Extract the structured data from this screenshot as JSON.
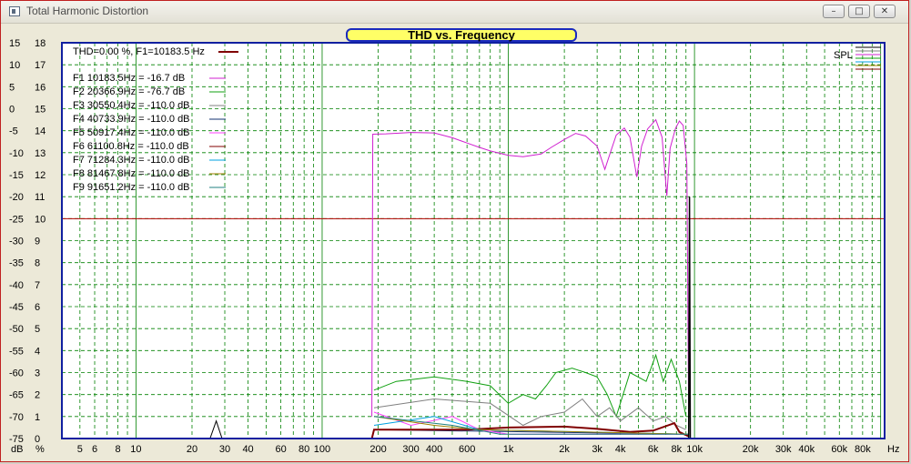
{
  "window": {
    "title": "Total Harmonic Distortion",
    "buttons": {
      "minimize": "–",
      "maximize": "□",
      "close": "✕"
    }
  },
  "chart_data": {
    "type": "line",
    "title": "THD vs. Frequency",
    "x_scale": "log",
    "xlim": [
      4,
      105000
    ],
    "x_unit_label": "Hz",
    "x_ticks": [
      {
        "v": 5,
        "l": "5"
      },
      {
        "v": 6,
        "l": "6"
      },
      {
        "v": 8,
        "l": "8"
      },
      {
        "v": 10,
        "l": "10"
      },
      {
        "v": 20,
        "l": "20"
      },
      {
        "v": 30,
        "l": "30"
      },
      {
        "v": 40,
        "l": "40"
      },
      {
        "v": 60,
        "l": "60"
      },
      {
        "v": 80,
        "l": "80"
      },
      {
        "v": 100,
        "l": "100"
      },
      {
        "v": 200,
        "l": "200"
      },
      {
        "v": 300,
        "l": "300"
      },
      {
        "v": 400,
        "l": "400"
      },
      {
        "v": 600,
        "l": "600"
      },
      {
        "v": 1000,
        "l": "1k"
      },
      {
        "v": 2000,
        "l": "2k"
      },
      {
        "v": 3000,
        "l": "3k"
      },
      {
        "v": 4000,
        "l": "4k"
      },
      {
        "v": 6000,
        "l": "6k"
      },
      {
        "v": 8000,
        "l": "8k"
      },
      {
        "v": 10000,
        "l": "10k"
      },
      {
        "v": 20000,
        "l": "20k"
      },
      {
        "v": 30000,
        "l": "30k"
      },
      {
        "v": 40000,
        "l": "40k"
      },
      {
        "v": 60000,
        "l": "60k"
      },
      {
        "v": 80000,
        "l": "80k"
      }
    ],
    "y_db_label": "dB",
    "y_pct_label": "%",
    "ylim_db": [
      -75,
      15
    ],
    "db_ticks": [
      "15",
      "10",
      "5",
      "0",
      "-5",
      "-10",
      "-15",
      "-20",
      "-25",
      "-30",
      "-35",
      "-40",
      "-45",
      "-50",
      "-55",
      "-60",
      "-65",
      "-70",
      "-75"
    ],
    "pct_ticks": [
      "18",
      "17",
      "16",
      "15",
      "14",
      "13",
      "12",
      "11",
      "10",
      "9",
      "8",
      "7",
      "6",
      "5",
      "4",
      "3",
      "2",
      "1",
      "0"
    ],
    "reference_line_db": -25,
    "grid": true,
    "legend_position": "top-left",
    "thd_label": "THD=0.00 %, F1=10183.5 Hz",
    "spl_label": "SPL",
    "series": [
      {
        "name": "F1 10183.5Hz = -16.7 dB",
        "color": "#d020d0",
        "points": [
          [
            185,
            -70
          ],
          [
            187,
            -5.8
          ],
          [
            220,
            -5.7
          ],
          [
            300,
            -5.4
          ],
          [
            400,
            -5.5
          ],
          [
            500,
            -6.6
          ],
          [
            600,
            -7.8
          ],
          [
            700,
            -8.8
          ],
          [
            800,
            -9.6
          ],
          [
            1000,
            -10.6
          ],
          [
            1200,
            -10.9
          ],
          [
            1500,
            -10.3
          ],
          [
            1700,
            -8.8
          ],
          [
            2000,
            -7.0
          ],
          [
            2300,
            -5.6
          ],
          [
            2600,
            -6.2
          ],
          [
            3000,
            -8.5
          ],
          [
            3300,
            -13.8
          ],
          [
            3500,
            -10.5
          ],
          [
            3800,
            -6.0
          ],
          [
            4200,
            -4.4
          ],
          [
            4500,
            -6.5
          ],
          [
            4900,
            -15.5
          ],
          [
            5200,
            -8.5
          ],
          [
            5600,
            -4.6
          ],
          [
            6200,
            -2.5
          ],
          [
            6700,
            -6.5
          ],
          [
            7100,
            -19.8
          ],
          [
            7400,
            -9.0
          ],
          [
            7900,
            -4.5
          ],
          [
            8300,
            -2.8
          ],
          [
            8700,
            -3.8
          ],
          [
            9100,
            -12.5
          ],
          [
            9300,
            -70
          ]
        ]
      },
      {
        "name": "F2 20366.9Hz = -76.7 dB",
        "color": "#10a010",
        "points": [
          [
            190,
            -64
          ],
          [
            250,
            -62
          ],
          [
            400,
            -61
          ],
          [
            600,
            -62
          ],
          [
            800,
            -63
          ],
          [
            1000,
            -67
          ],
          [
            1200,
            -65
          ],
          [
            1400,
            -66
          ],
          [
            1600,
            -63
          ],
          [
            1800,
            -60
          ],
          [
            2200,
            -59
          ],
          [
            2600,
            -60
          ],
          [
            3000,
            -61
          ],
          [
            3400,
            -65
          ],
          [
            3800,
            -70
          ],
          [
            4500,
            -60
          ],
          [
            5500,
            -62
          ],
          [
            6200,
            -56
          ],
          [
            6800,
            -62
          ],
          [
            7500,
            -57
          ],
          [
            8300,
            -62
          ],
          [
            9000,
            -70
          ]
        ]
      },
      {
        "name": "F3 30550.4Hz = -110.0 dB",
        "color": "#808080",
        "points": [
          [
            190,
            -68
          ],
          [
            400,
            -66
          ],
          [
            800,
            -67
          ],
          [
            1200,
            -72
          ],
          [
            1500,
            -70
          ],
          [
            2000,
            -69
          ],
          [
            2500,
            -66
          ],
          [
            3000,
            -70
          ],
          [
            3500,
            -68
          ],
          [
            4000,
            -71
          ],
          [
            5000,
            -68
          ],
          [
            6000,
            -71
          ],
          [
            7000,
            -70
          ],
          [
            8000,
            -72
          ],
          [
            9000,
            -73
          ]
        ]
      },
      {
        "name": "F4 40733.9Hz = -110.0 dB",
        "color": "#103070",
        "points": [
          [
            190,
            -73
          ],
          [
            9300,
            -74
          ]
        ]
      },
      {
        "name": "F5 50917.4Hz = -110.0 dB",
        "color": "#ff40ff",
        "points": [
          [
            190,
            -69
          ],
          [
            300,
            -72
          ],
          [
            500,
            -70
          ],
          [
            700,
            -73
          ],
          [
            1000,
            -74
          ],
          [
            9300,
            -74
          ]
        ]
      },
      {
        "name": "F6 61100.8Hz = -110.0 dB",
        "color": "#800000",
        "points": [
          [
            185,
            -75
          ],
          [
            190,
            -73
          ],
          [
            600,
            -73
          ],
          [
            1000,
            -72.5
          ],
          [
            2000,
            -72.3
          ],
          [
            3000,
            -72.8
          ],
          [
            4500,
            -73.5
          ],
          [
            6000,
            -73.2
          ],
          [
            7800,
            -71.5
          ],
          [
            8300,
            -73.5
          ],
          [
            9300,
            -74.5
          ]
        ]
      },
      {
        "name": "F7 71284.3Hz = -110.0 dB",
        "color": "#00a0e0",
        "points": [
          [
            190,
            -72
          ],
          [
            400,
            -70
          ],
          [
            700,
            -73
          ],
          [
            9300,
            -74
          ]
        ]
      },
      {
        "name": "F8 81467.8Hz = -110.0 dB",
        "color": "#a08000",
        "points": [
          [
            190,
            -70
          ],
          [
            400,
            -72
          ],
          [
            700,
            -73
          ],
          [
            9300,
            -74
          ]
        ]
      },
      {
        "name": "F9 91651.2Hz = -110.0 dB",
        "color": "#208080",
        "points": [
          [
            190,
            -70
          ],
          [
            500,
            -72
          ],
          [
            900,
            -74
          ],
          [
            9300,
            -74
          ]
        ]
      }
    ],
    "spl_series": {
      "name": "SPL",
      "color": "#000000",
      "points": [
        [
          9300,
          -75
        ],
        [
          9400,
          -20
        ],
        [
          9500,
          -75
        ]
      ]
    },
    "low_freq_bump": {
      "color": "#000000",
      "points": [
        [
          25,
          -75
        ],
        [
          27,
          -71
        ],
        [
          29,
          -75
        ]
      ]
    }
  }
}
